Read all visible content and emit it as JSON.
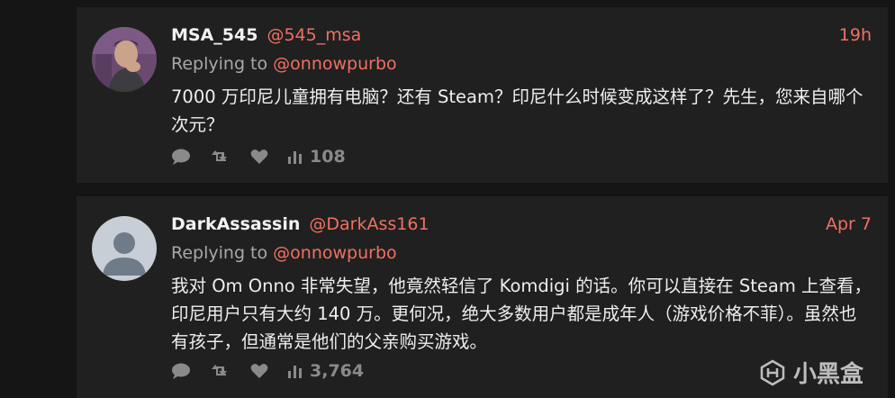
{
  "tweets": [
    {
      "name": "MSA_545",
      "handle": "@545_msa",
      "time": "19h",
      "replying_prefix": "Replying to ",
      "replying_to": "@onnowpurbo",
      "text": "7000 万印尼儿童拥有电脑？还有 Steam？印尼什么时候变成这样了？先生，您来自哪个次元？",
      "views": "108",
      "avatar_icon": "user-photo"
    },
    {
      "name": "DarkAssassin",
      "handle": "@DarkAss161",
      "time": "Apr 7",
      "replying_prefix": "Replying to ",
      "replying_to": "@onnowpurbo",
      "text": "我对 Om Onno 非常失望，他竟然轻信了 Komdigi 的话。你可以直接在 Steam 上查看，印尼用户只有大约 140 万。更何况，绝大多数用户都是成年人（游戏价格不菲）。虽然也有孩子，但通常是他们的父亲购买游戏。",
      "views": "3,764",
      "avatar_icon": "default-user-avatar"
    }
  ],
  "watermark": {
    "text": "小黑盒"
  },
  "colors": {
    "accent": "#f07062",
    "card": "#202020",
    "background": "#151515"
  }
}
